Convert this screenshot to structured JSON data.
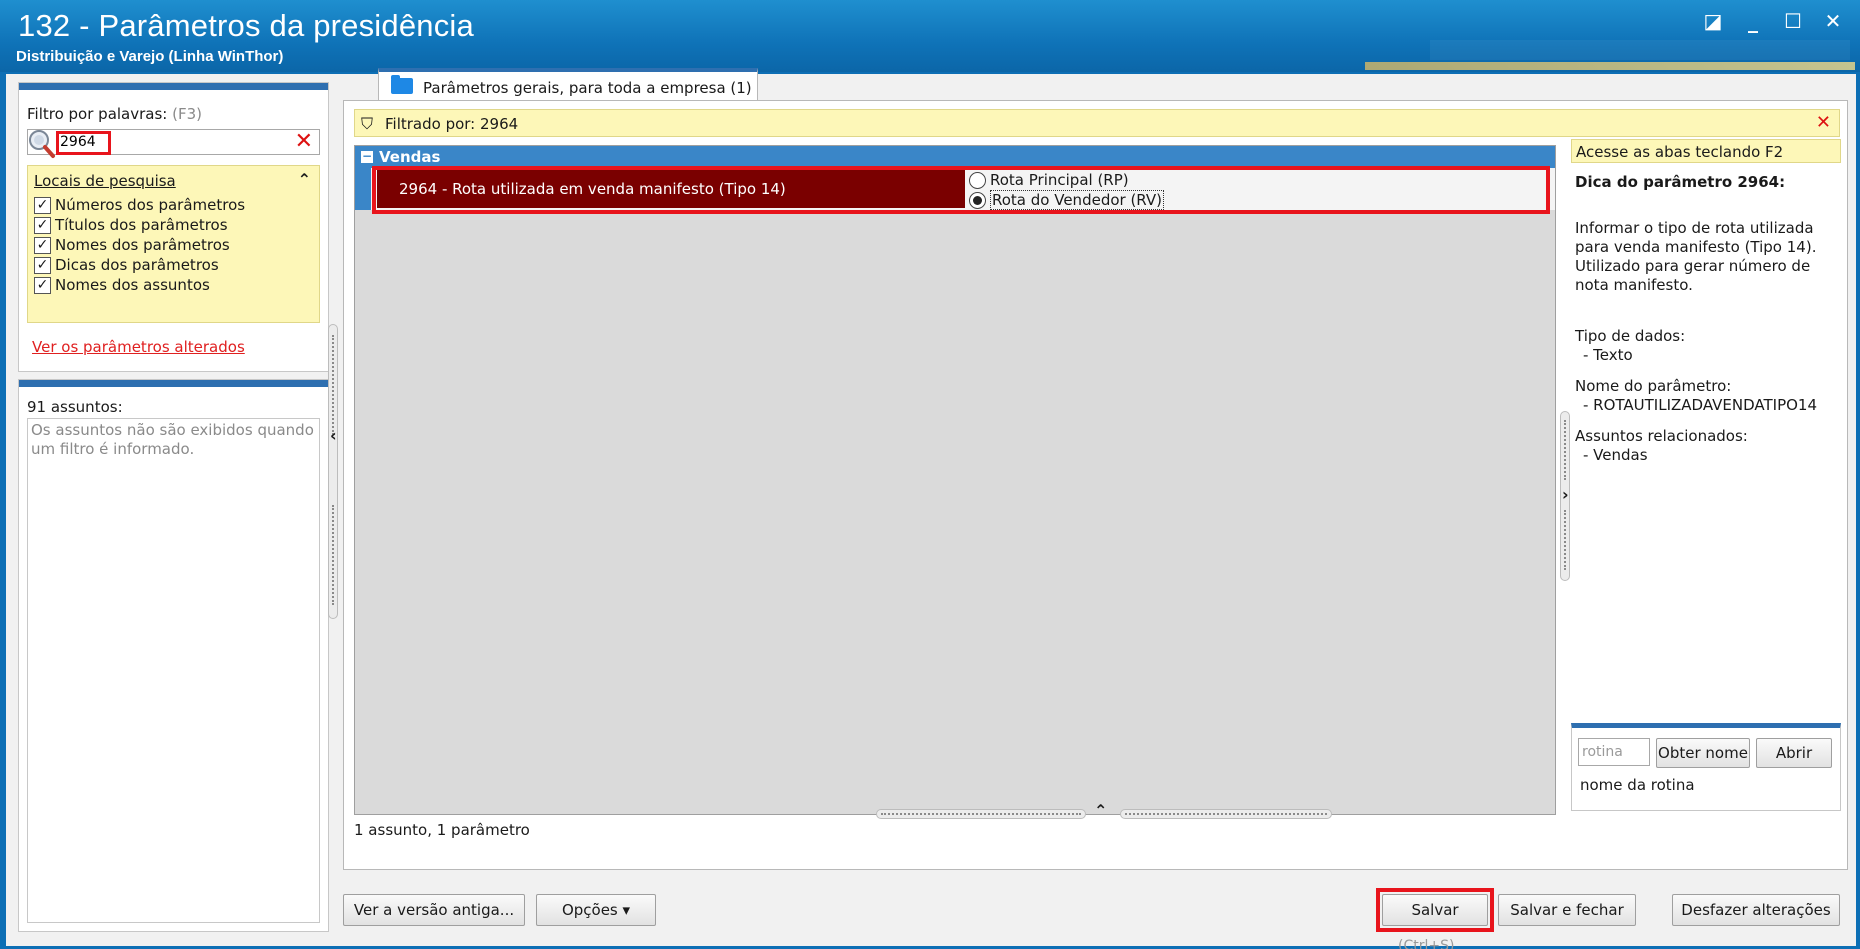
{
  "window": {
    "title": "132 - Parâmetros da presidência",
    "subtitle": "Distribuição e Varejo (Linha WinThor)",
    "controls": {
      "restore": "◪",
      "minimize": "_",
      "maximize": "☐",
      "close": "✕"
    }
  },
  "filter": {
    "label": "Filtro por palavras:",
    "hint": "(F3)",
    "value": "2964",
    "clear": "✕"
  },
  "search_locations": {
    "title": "Locais de pesquisa",
    "collapse": "⌃",
    "items": [
      {
        "label": "Números dos parâmetros",
        "checked": true
      },
      {
        "label": "Títulos dos parâmetros",
        "checked": true
      },
      {
        "label": "Nomes dos parâmetros",
        "checked": true
      },
      {
        "label": "Dicas dos parâmetros",
        "checked": true
      },
      {
        "label": "Nomes dos assuntos",
        "checked": true
      }
    ],
    "check_glyph": "✓"
  },
  "altered_link": "Ver os parâmetros alterados",
  "subjects": {
    "count": "91 assuntos:",
    "empty_message": "Os assuntos não são exibidos quando um filtro é informado."
  },
  "tab": {
    "label": "Parâmetros gerais, para toda a empresa  (1)"
  },
  "filter_bar": {
    "icon": "⛉",
    "text": "Filtrado por: 2964",
    "close": "✕"
  },
  "grid": {
    "group": {
      "toggle": "−",
      "label": "Vendas"
    },
    "parameter": {
      "label": "2964 - Rota utilizada em venda manifesto (Tipo 14)",
      "options": [
        {
          "label": "Rota Principal (RP)",
          "selected": false
        },
        {
          "label": "Rota do Vendedor (RV)",
          "selected": true
        }
      ]
    },
    "status": "1 assunto, 1 parâmetro"
  },
  "help": {
    "tip": "Acesse as abas teclando F2",
    "title": "Dica do parâmetro 2964:",
    "description": "Informar o tipo de rota utilizada para venda manifesto (Tipo 14). Utilizado para gerar número de nota manifesto.",
    "data_type_label": "Tipo de dados:",
    "data_type_value": "- Texto",
    "param_name_label": "Nome do parâmetro:",
    "param_name_value": "- ROTAUTILIZADAVENDATIPO14",
    "related_label": "Assuntos relacionados:",
    "related_value": "- Vendas"
  },
  "routine": {
    "placeholder": "rotina",
    "get_name_button": "Obter nome",
    "open_button": "Abrir",
    "name_label": "nome da rotina"
  },
  "footer": {
    "old_version_button": "Ver a versão antiga...",
    "options_button": "Opções ▾",
    "save_button": "Salvar",
    "save_close_button": "Salvar e fechar",
    "undo_button": "Desfazer alterações",
    "save_shortcut": "(Ctrl+S)"
  },
  "colors": {
    "accent": "#2e6fb0",
    "highlight": "#e8141c",
    "selected_row": "#7a0000",
    "tip_background": "#fdf7b8"
  }
}
